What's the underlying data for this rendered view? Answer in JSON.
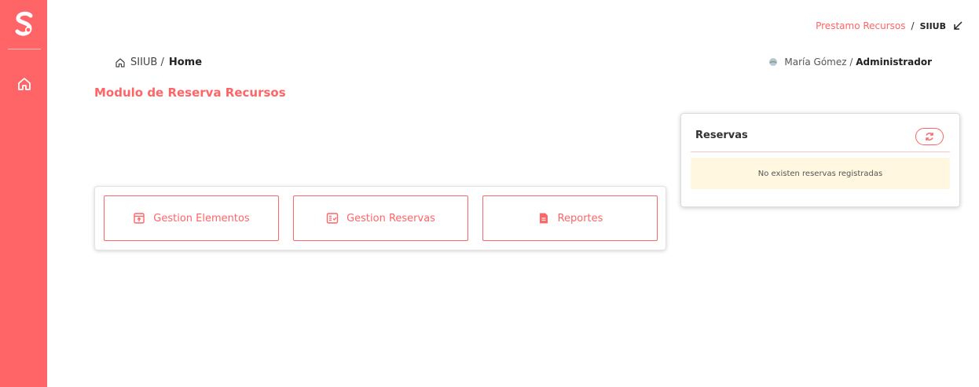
{
  "colors": {
    "accent": "#ff6467",
    "alert_bg": "#fff7e0"
  },
  "sidebar": {
    "logo_icon": "s-logo-icon",
    "nav_icon": "home-icon"
  },
  "top_links": {
    "parent": "Prestamo Recursos",
    "separator": "/",
    "current": "SIIUB"
  },
  "breadcrumb": {
    "root": "SIIUB / ",
    "current": "Home"
  },
  "user": {
    "name": "María Gómez / ",
    "role": "Administrador"
  },
  "module_title": "Modulo de Reserva Recursos",
  "actions": [
    {
      "label": "Gestion Elementos",
      "icon": "archive-up-icon"
    },
    {
      "label": "Gestion Reservas",
      "icon": "checklist-icon"
    },
    {
      "label": "Reportes",
      "icon": "document-icon"
    }
  ],
  "reservas": {
    "title": "Reservas",
    "empty_message": "No existen reservas registradas",
    "refresh_icon": "refresh-icon"
  }
}
